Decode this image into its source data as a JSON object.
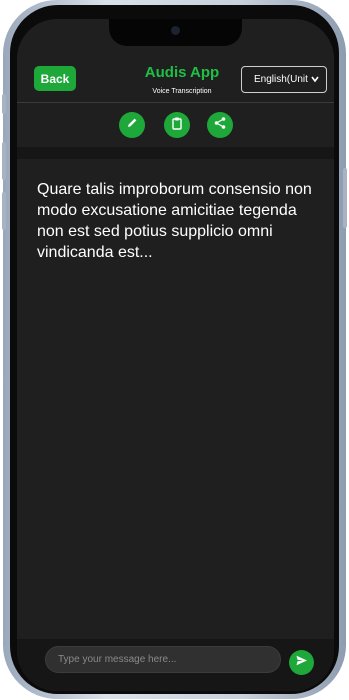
{
  "header": {
    "back_label": "Back",
    "title": "Audis App",
    "subtitle": "Voice Transcription",
    "language_selected": "English(Unit"
  },
  "toolbar": {
    "buttons": [
      {
        "icon": "pencil-icon"
      },
      {
        "icon": "clipboard-icon"
      },
      {
        "icon": "share-icon"
      }
    ]
  },
  "content": {
    "text": "Quare talis improborum consensio non modo excusatione amicitiae tegenda non est sed potius supplicio omni vindicanda est..."
  },
  "composer": {
    "placeholder": "Type your message here...",
    "send_icon": "send-icon"
  },
  "colors": {
    "accent": "#1ea83a",
    "title": "#1fbf45",
    "background": "#1f1f1f"
  }
}
